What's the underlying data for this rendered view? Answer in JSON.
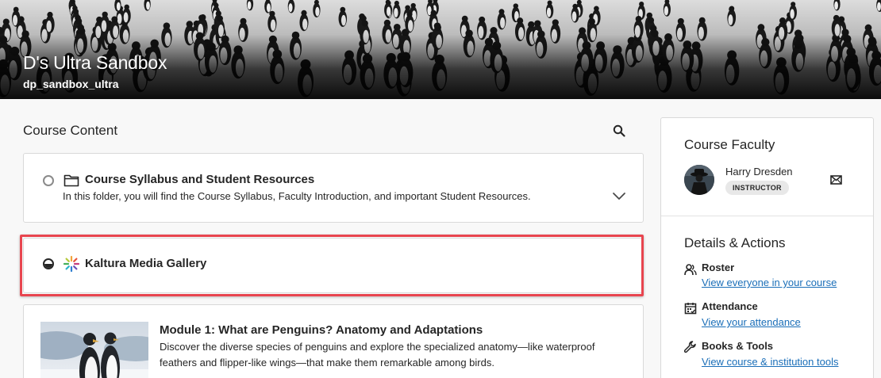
{
  "banner": {
    "course_title": "D's Ultra Sandbox",
    "course_code": "dp_sandbox_ultra"
  },
  "content": {
    "heading": "Course Content",
    "search_icon": "search-icon",
    "items": [
      {
        "title": "Course Syllabus and Student Resources",
        "description": "In this folder, you will find the Course Syllabus, Faculty Introduction, and important Student Resources.",
        "icon": "folder-icon",
        "progress": "not-started"
      },
      {
        "title": "Kaltura Media Gallery",
        "icon": "kaltura-icon",
        "progress": "partial"
      },
      {
        "title": "Module 1: What are Penguins? Anatomy and Adaptations",
        "description_line1": "Discover the diverse species of penguins and explore the specialized anatomy—like waterproof",
        "description_line2": "feathers and flipper-like wings—that make them remarkable among birds."
      }
    ]
  },
  "faculty": {
    "heading": "Course Faculty",
    "name": "Harry Dresden",
    "role": "INSTRUCTOR"
  },
  "details": {
    "heading": "Details & Actions",
    "actions": [
      {
        "label": "Roster",
        "link": "View everyone in your course",
        "icon": "roster-icon"
      },
      {
        "label": "Attendance",
        "link": "View your attendance",
        "icon": "attendance-icon"
      },
      {
        "label": "Books & Tools",
        "link": "View course & institution tools",
        "icon": "wrench-icon"
      }
    ]
  },
  "colors": {
    "highlight": "#e8454f",
    "link": "#1a6eb8"
  }
}
